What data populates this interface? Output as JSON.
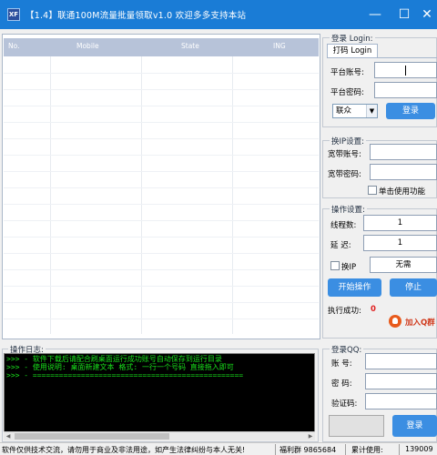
{
  "window": {
    "logo": "XF",
    "title": "【1.4】联通100M流量批量领取v1.0    欢迎多多支持本站",
    "controls": {
      "minimize": "—",
      "maximize": "☐",
      "close": "✕"
    }
  },
  "list": {
    "columns": [
      "No.",
      "Mobile",
      "State",
      "ING"
    ],
    "rows": []
  },
  "login": {
    "group_title": "登录 Login:",
    "tab": "打码 Login",
    "platform_account_label": "平台账号:",
    "platform_password_label": "平台密码:",
    "platform_select": "联众",
    "login_button": "登录"
  },
  "ip_settings": {
    "group_title": "换IP设置:",
    "broadband_account_label": "宽带账号:",
    "broadband_password_label": "宽带密码:",
    "single_use_label": "单击使用功能"
  },
  "op_settings": {
    "group_title": "操作设置:",
    "threads_label": "线程数:",
    "threads_value": "1",
    "delay_label": "延 迟:",
    "delay_value": "1",
    "change_ip_label": "换IP",
    "change_ip_value": "无需",
    "start_button": "开始操作",
    "stop_button": "停止",
    "success_label": "执行成功:",
    "success_value": "0",
    "join_qq_label": "加入Q群"
  },
  "log": {
    "group_title": "操作日志:",
    "lines": [
      ">>> - 软件下载后请配合刷桌面运行成功账号自动保存到运行目录",
      ">>> - 使用说明: 桌面新建文本 格式: 一行一个号码 直接拖入即可",
      ">>> - ================================================"
    ]
  },
  "qq_login": {
    "group_title": "登录QQ:",
    "account_label": "账 号:",
    "password_label": "密 码:",
    "captcha_label": "验证码:",
    "login_button": "登录"
  },
  "status_bar": {
    "notice": "软件仅供技术交流，请勿用于商业及非法用途，如产生法律纠纷与本人无关!",
    "group": "福利群 9865684",
    "usage_label": "累计使用:",
    "usage_count": "139009"
  },
  "colors": {
    "titlebar": "#1a7cd6",
    "button": "#3b8ee2",
    "log_text": "#18e01b",
    "success": "#e02020"
  }
}
